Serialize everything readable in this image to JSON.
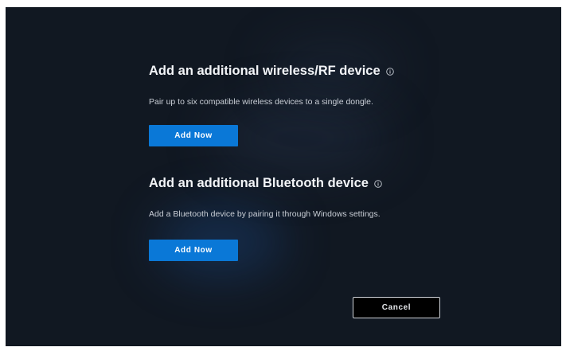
{
  "wireless_section": {
    "title": "Add an additional wireless/RF device",
    "info_icon": "info-circle-icon",
    "description": "Pair up to six compatible wireless devices to a single dongle.",
    "button_label": "Add Now"
  },
  "bluetooth_section": {
    "title": "Add an additional Bluetooth device",
    "info_icon": "info-circle-icon",
    "description": "Add a Bluetooth device by pairing it through Windows settings.",
    "button_label": "Add Now"
  },
  "footer": {
    "cancel_label": "Cancel"
  },
  "colors": {
    "background": "#111822",
    "primary_button": "#0a78d7",
    "text": "#f2f4f7",
    "secondary_text": "#c9ced6"
  }
}
